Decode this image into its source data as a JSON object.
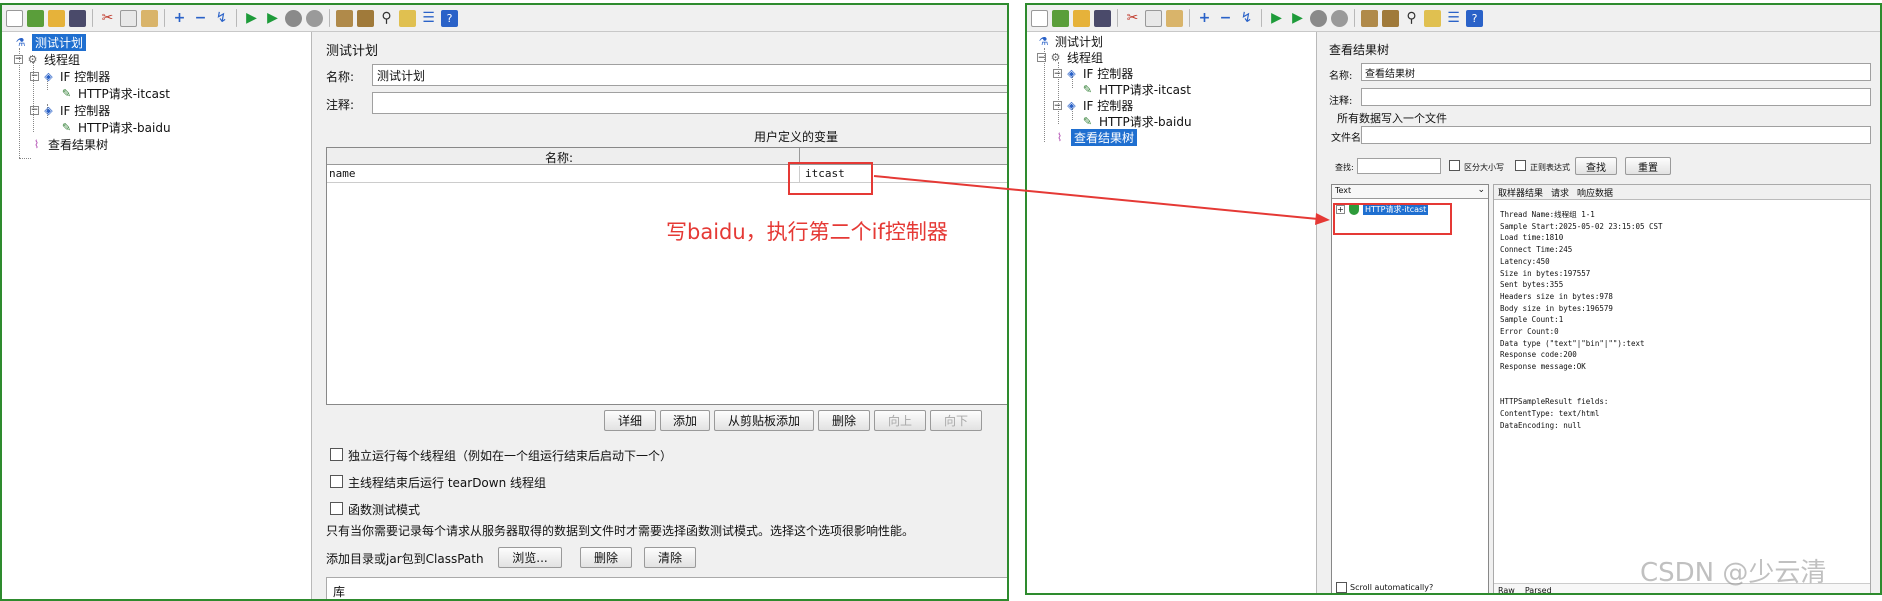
{
  "left": {
    "tree": {
      "items": [
        {
          "label": "测试计划"
        },
        {
          "label": "线程组"
        },
        {
          "label": "IF 控制器"
        },
        {
          "label": "HTTP请求-itcast"
        },
        {
          "label": "IF 控制器"
        },
        {
          "label": "HTTP请求-baidu"
        },
        {
          "label": "查看结果树"
        }
      ]
    },
    "form": {
      "title": "测试计划",
      "name_label": "名称:",
      "name_value": "测试计划",
      "comment_label": "注释:",
      "comment_value": "",
      "vars_title": "用户定义的变量",
      "table_header_name": "名称:",
      "table_header_value": "",
      "rows": [
        {
          "name": "name",
          "value": "itcast"
        }
      ],
      "buttons": {
        "detail": "详细",
        "add": "添加",
        "paste": "从剪贴板添加",
        "delete": "删除",
        "up": "向上",
        "down": "向下"
      },
      "checkboxes": [
        {
          "label": "独立运行每个线程组（例如在一个组运行结束后启动下一个）"
        },
        {
          "label": "主线程结束后运行 tearDown 线程组"
        },
        {
          "label": "函数测试模式"
        }
      ],
      "hint": "只有当你需要记录每个请求从服务器取得的数据到文件时才需要选择函数测试模式。选择这个选项很影响性能。",
      "classpath_label": "添加目录或jar包到ClassPath",
      "browse_button": "浏览...",
      "cp_delete_button": "删除",
      "clear_button": "清除",
      "lib_header": "库"
    }
  },
  "annotation": {
    "text": "写baidu，执行第二个if控制器",
    "color": "#e53935"
  },
  "right": {
    "tree": {
      "items": [
        {
          "label": "测试计划"
        },
        {
          "label": "线程组"
        },
        {
          "label": "IF 控制器"
        },
        {
          "label": "HTTP请求-itcast"
        },
        {
          "label": "IF 控制器"
        },
        {
          "label": "HTTP请求-baidu"
        },
        {
          "label": "查看结果树"
        }
      ]
    },
    "form": {
      "title": "查看结果树",
      "name_label": "名称:",
      "name_value": "查看结果树",
      "comment_label": "注释:",
      "comment_value": "",
      "write_all_label": "所有数据写入一个文件",
      "filename_label": "文件名",
      "filename_value": "",
      "search_label": "查找:",
      "search_value": "",
      "case_label": "区分大小写",
      "regex_label": "正则表达式",
      "find_button": "查找",
      "reset_button": "重置",
      "renderer_value": "Text",
      "result_node": "HTTP请求-itcast",
      "tabs": [
        "取样器结果",
        "请求",
        "响应数据"
      ],
      "result_lines": [
        "Thread Name:线程组 1-1",
        "Sample Start:2025-05-02 23:15:05 CST",
        "Load time:1810",
        "Connect Time:245",
        "Latency:450",
        "Size in bytes:197557",
        "Sent bytes:355",
        "Headers size in bytes:978",
        "Body size in bytes:196579",
        "Sample Count:1",
        "Error Count:0",
        "Data type (\"text\"|\"bin\"|\"\"):text",
        "Response code:200",
        "Response message:OK",
        "",
        "",
        "HTTPSampleResult fields:",
        "ContentType: text/html",
        "DataEncoding: null"
      ],
      "scroll_label": "Scroll automatically?",
      "bottom_tabs": [
        "Raw",
        "Parsed"
      ]
    }
  },
  "watermark": "CSDN @少云清",
  "colors": {
    "frame_green": "#2e8b2e",
    "selection": "#1f6fd0",
    "annotation_red": "#e53935"
  }
}
